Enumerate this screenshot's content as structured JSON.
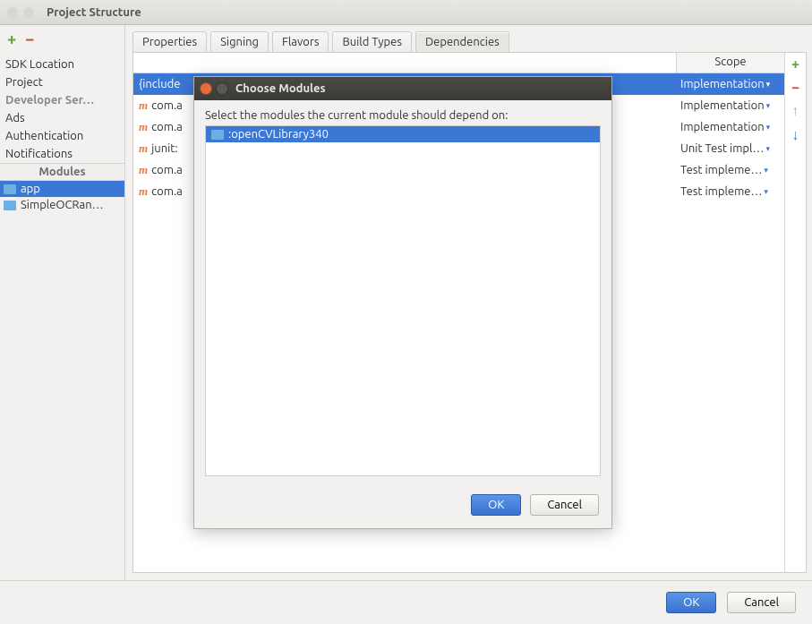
{
  "window": {
    "title": "Project Structure"
  },
  "sidebar": {
    "items": [
      "SDK Location",
      "Project",
      "Developer Ser…",
      "Ads",
      "Authentication",
      "Notifications"
    ],
    "modules_header": "Modules",
    "modules": [
      "app",
      "SimpleOCRan…"
    ]
  },
  "tabs": [
    "Properties",
    "Signing",
    "Flavors",
    "Build Types",
    "Dependencies"
  ],
  "active_tab": 4,
  "dependencies": {
    "scope_header": "Scope",
    "rows": [
      {
        "icon": "include",
        "label": "{include",
        "scope": "Implementation",
        "selected": true
      },
      {
        "icon": "m",
        "label": "com.a",
        "scope": "Implementation"
      },
      {
        "icon": "m",
        "label": "com.a",
        "scope": "Implementation"
      },
      {
        "icon": "m",
        "label": "junit:",
        "scope": "Unit Test impl…"
      },
      {
        "icon": "m",
        "label": "com.a",
        "scope": "Test impleme…"
      },
      {
        "icon": "m",
        "label": "com.a",
        "scope": "Test impleme…"
      }
    ]
  },
  "chooser": {
    "title": "Choose Modules",
    "instruction": "Select the modules the current module should depend on:",
    "items": [
      ":openCVLibrary340"
    ],
    "ok": "OK",
    "cancel": "Cancel"
  },
  "footer": {
    "ok": "OK",
    "cancel": "Cancel"
  }
}
